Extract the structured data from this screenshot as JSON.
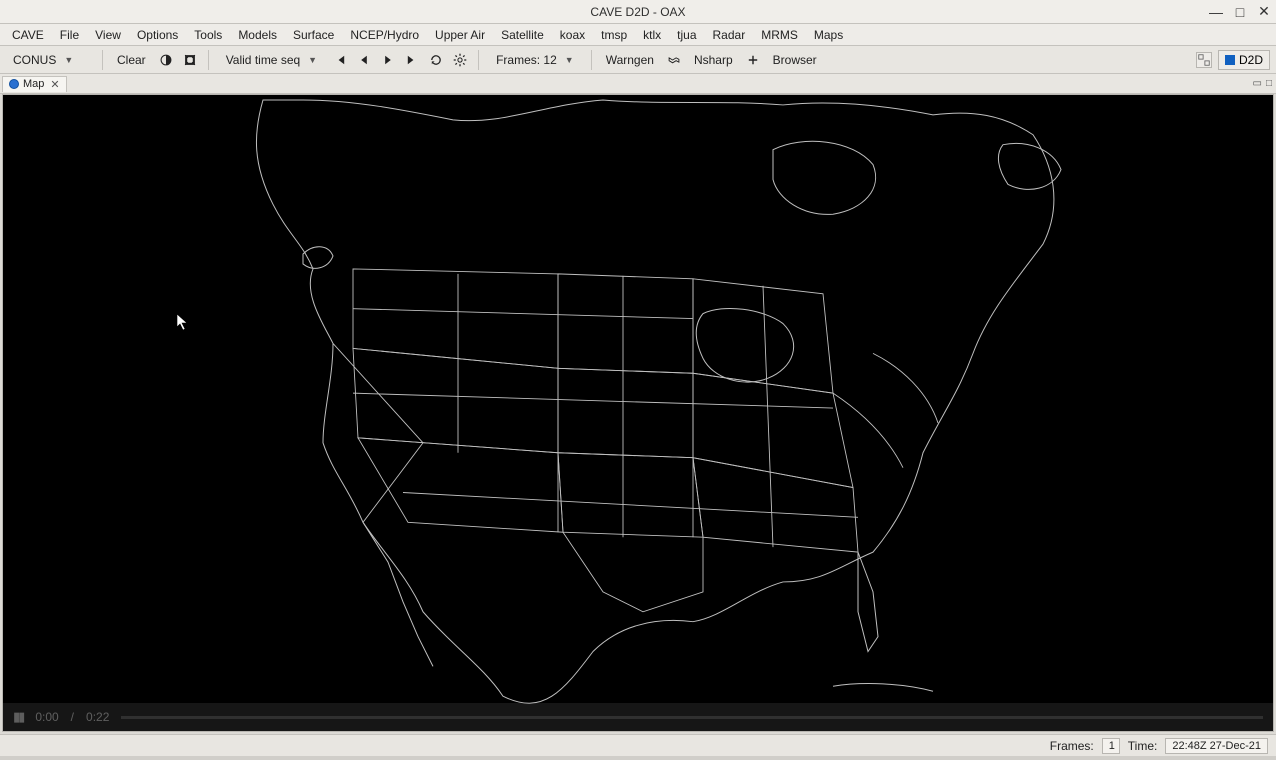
{
  "window": {
    "title": "CAVE D2D - OAX",
    "minimize_glyph": "—",
    "maximize_glyph": "□",
    "close_glyph": "✕"
  },
  "menubar": {
    "items": [
      "CAVE",
      "File",
      "View",
      "Options",
      "Tools",
      "Models",
      "Surface",
      "NCEP/Hydro",
      "Upper Air",
      "Satellite",
      "koax",
      "tmsp",
      "ktlx",
      "tjua",
      "Radar",
      "MRMS",
      "Maps"
    ]
  },
  "toolbar": {
    "scale_selector": "CONUS",
    "clear_label": "Clear",
    "time_mode": "Valid time seq",
    "frames_label": "Frames: 12",
    "warngen_label": "Warngen",
    "nsharp_label": "Nsharp",
    "browser_label": "Browser",
    "perspective_label": "D2D"
  },
  "tabs": {
    "map_label": "Map",
    "close_glyph": "✕"
  },
  "video_overlay": {
    "elapsed": "0:00",
    "sep": "/",
    "total": "0:22"
  },
  "statusbar": {
    "frames_label": "Frames:",
    "frames_value": "1",
    "time_label": "Time:",
    "time_value": "22:48Z 27-Dec-21"
  }
}
